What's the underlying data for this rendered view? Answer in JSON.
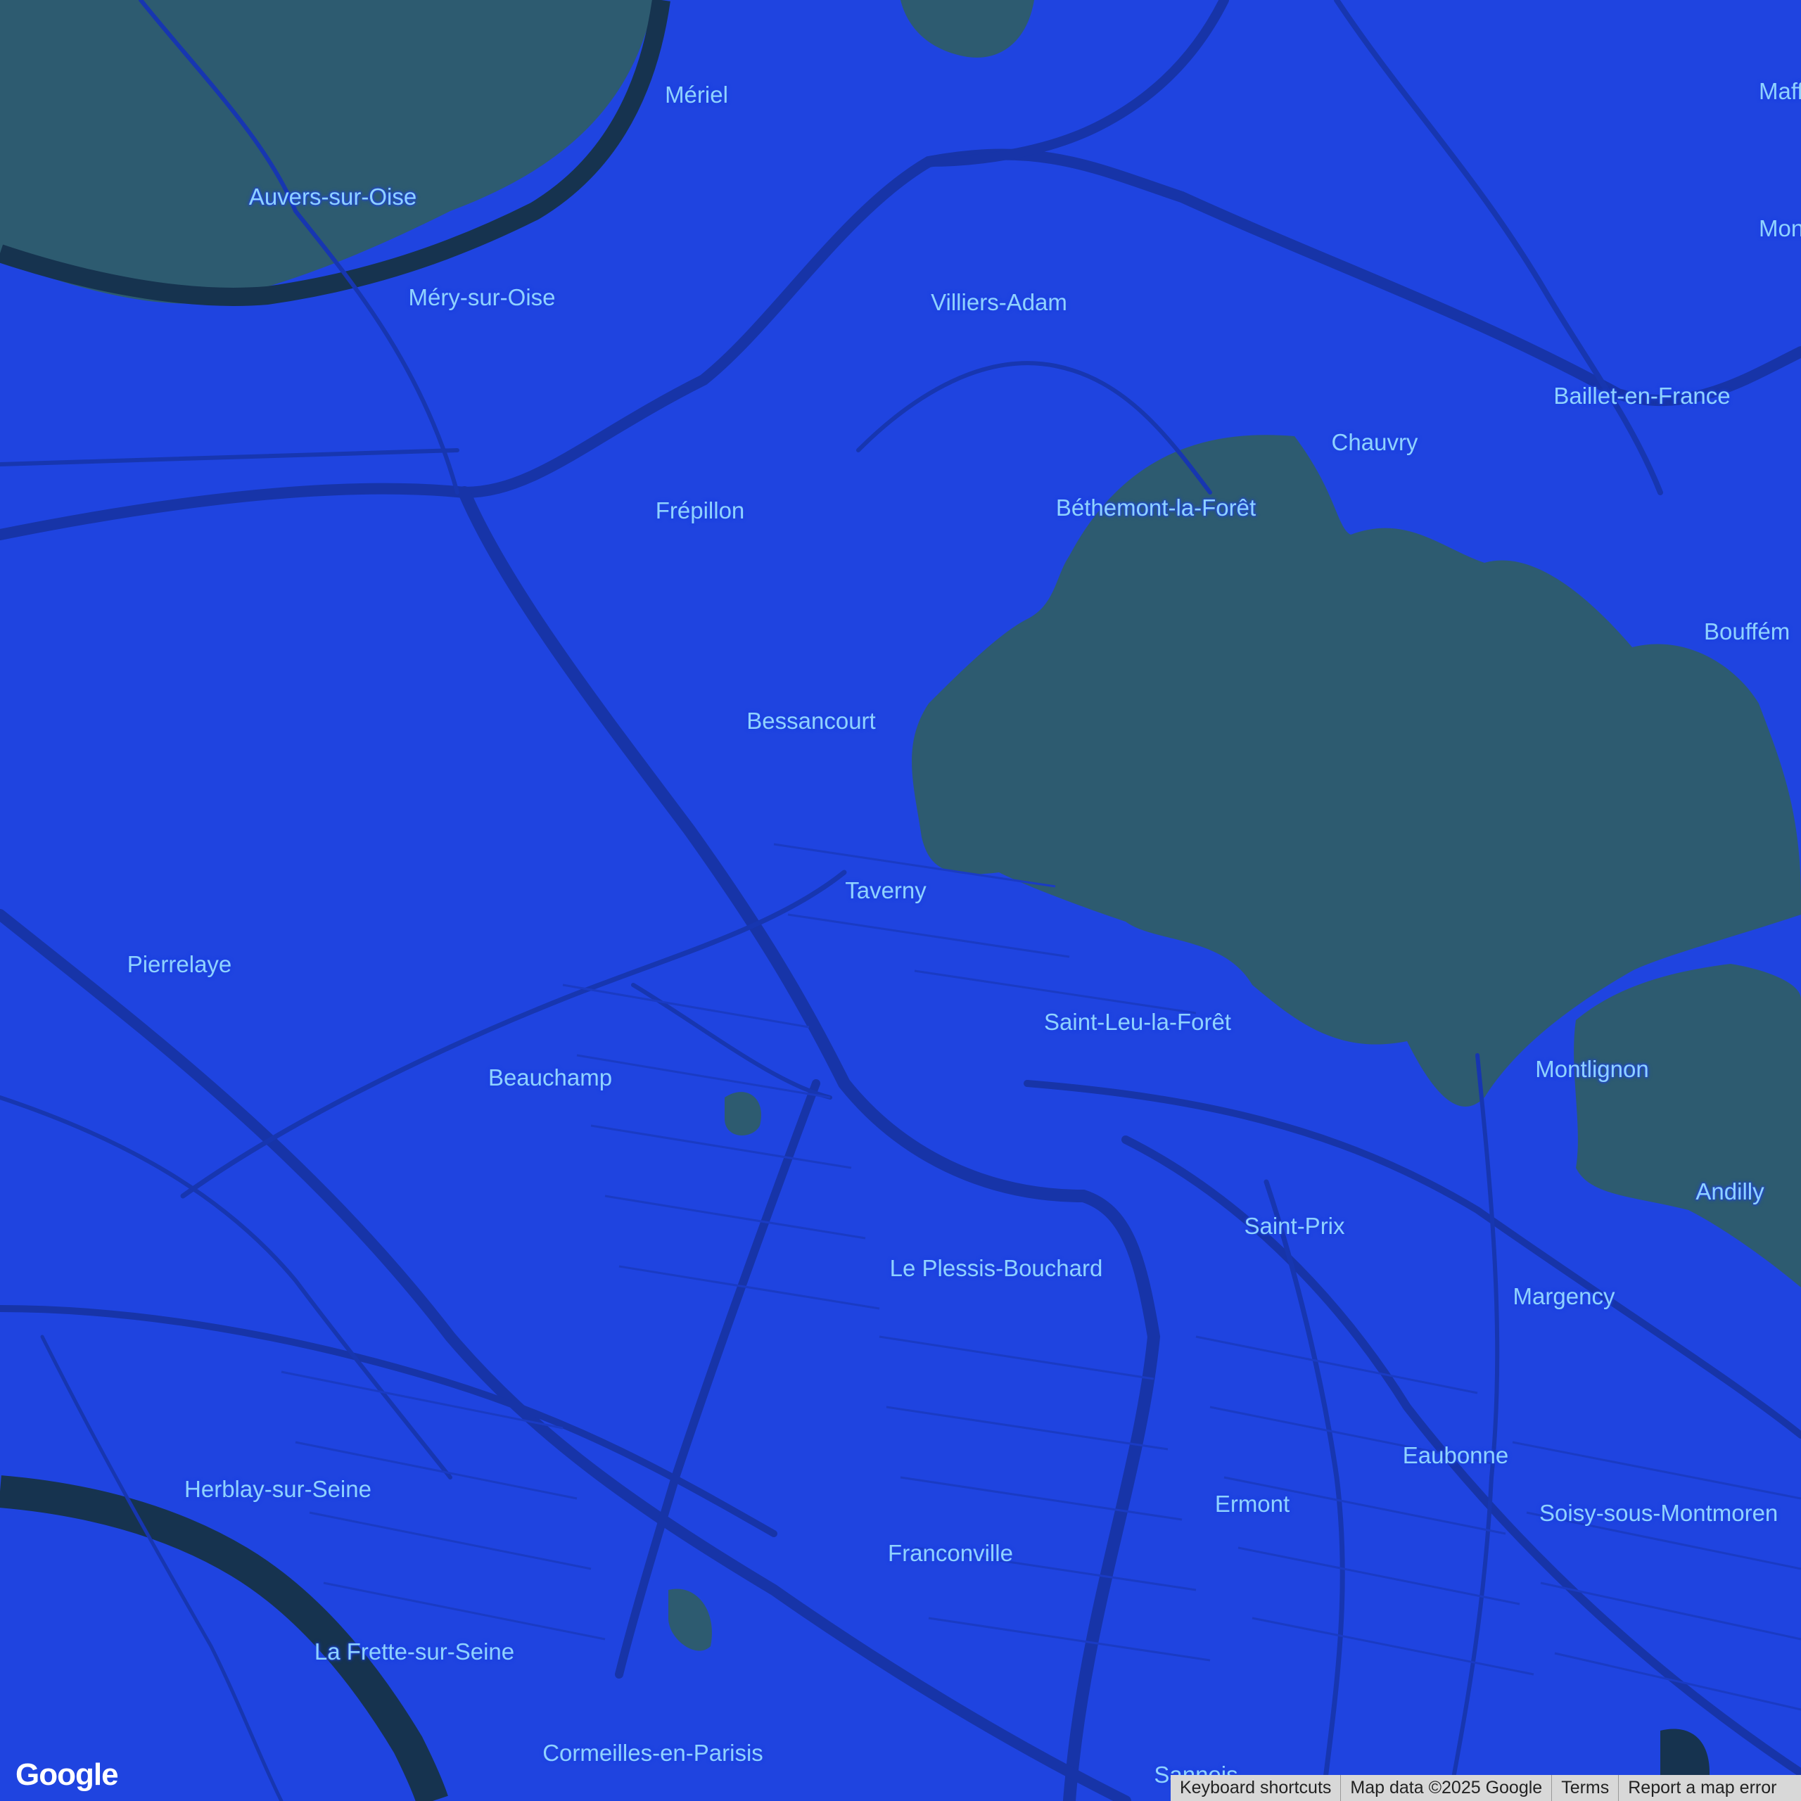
{
  "map": {
    "colors": {
      "land": "#1f44e0",
      "road": "#1736b0",
      "road_major": "#1734a8",
      "forest": "#2d5b70",
      "water": "#16334f",
      "label": "#8fd2ff"
    },
    "places": [
      {
        "id": "meriel",
        "name": "Mériel"
      },
      {
        "id": "auvers",
        "name": "Auvers-sur-Oise"
      },
      {
        "id": "mery",
        "name": "Méry-sur-Oise"
      },
      {
        "id": "villiers",
        "name": "Villiers-Adam"
      },
      {
        "id": "frepillon",
        "name": "Frépillon"
      },
      {
        "id": "bethemont",
        "name": "Béthemont-la-Forêt"
      },
      {
        "id": "chauvry",
        "name": "Chauvry"
      },
      {
        "id": "baillet",
        "name": "Baillet-en-France"
      },
      {
        "id": "mafflier",
        "name": "Mafflier"
      },
      {
        "id": "mon",
        "name": "Mon"
      },
      {
        "id": "bouffem",
        "name": "Bouffém"
      },
      {
        "id": "bessancourt",
        "name": "Bessancourt"
      },
      {
        "id": "taverny",
        "name": "Taverny"
      },
      {
        "id": "pierrelaye",
        "name": "Pierrelaye"
      },
      {
        "id": "saintleu",
        "name": "Saint-Leu-la-Forêt"
      },
      {
        "id": "beauchamp",
        "name": "Beauchamp"
      },
      {
        "id": "montlignon",
        "name": "Montlignon"
      },
      {
        "id": "andilly",
        "name": "Andilly"
      },
      {
        "id": "saintprix",
        "name": "Saint-Prix"
      },
      {
        "id": "plessis",
        "name": "Le Plessis-Bouchard"
      },
      {
        "id": "margency",
        "name": "Margency"
      },
      {
        "id": "eaubonne",
        "name": "Eaubonne"
      },
      {
        "id": "herblay",
        "name": "Herblay-sur-Seine"
      },
      {
        "id": "ermont",
        "name": "Ermont"
      },
      {
        "id": "soisy",
        "name": "Soisy-sous-Montmoren"
      },
      {
        "id": "franconville",
        "name": "Franconville"
      },
      {
        "id": "lafrette",
        "name": "La Frette-sur-Seine"
      },
      {
        "id": "cormeilles",
        "name": "Cormeilles-en-Parisis"
      },
      {
        "id": "sannois",
        "name": "Sannois"
      }
    ]
  },
  "logo": {
    "text": "Google"
  },
  "attribution": {
    "shortcuts": "Keyboard shortcuts",
    "map_data": "Map data ©2025 Google",
    "terms": "Terms",
    "report": "Report a map error"
  }
}
